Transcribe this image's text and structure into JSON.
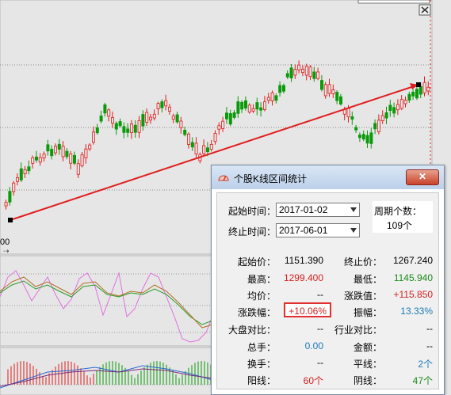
{
  "chart": {
    "y_tick_partial": "00",
    "colors": {
      "up": "#e21b1b",
      "down": "#0a9a0a",
      "trend": "#e02020",
      "bg": "#e6e6e6"
    }
  },
  "dialog": {
    "title": "个股K线区间统计",
    "close_label": "✕",
    "start_label": "起始时间：",
    "start_value": "2017-01-02",
    "end_label": "终止时间：",
    "end_value": "2017-06-01",
    "period_label": "周期个数：",
    "period_value": "109个",
    "stats": {
      "start_price_label": "起始价：",
      "start_price": "1151.390",
      "end_price_label": "终止价：",
      "end_price": "1267.240",
      "high_label": "最高：",
      "high": "1299.400",
      "low_label": "最低：",
      "low": "1145.940",
      "avg_label": "均价：",
      "avg": "--",
      "change_label": "涨跌值：",
      "change": "+115.850",
      "change_pct_label": "涨跌幅：",
      "change_pct": "+10.06%",
      "amplitude_label": "振幅：",
      "amplitude": "13.33%",
      "market_cmp_label": "大盘对比：",
      "market_cmp": "--",
      "industry_cmp_label": "行业对比：",
      "industry_cmp": "--",
      "volume_label": "总手：",
      "volume": "0.00",
      "amount_label": "金额：",
      "amount": "--",
      "turnover_label": "换手：",
      "turnover": "--",
      "flat_label": "平线：",
      "flat": "2个",
      "up_label": "阳线：",
      "up": "60个",
      "down_label": "阴线：",
      "down": "47个"
    }
  }
}
